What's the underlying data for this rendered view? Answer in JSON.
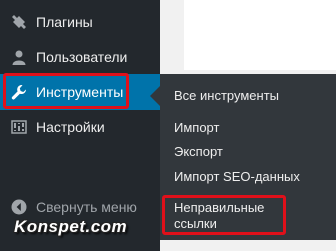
{
  "sidebar": {
    "items": [
      {
        "label": "Плагины",
        "icon": "plugin-icon"
      },
      {
        "label": "Пользователи",
        "icon": "users-icon"
      },
      {
        "label": "Инструменты",
        "icon": "wrench-icon",
        "active": true
      },
      {
        "label": "Настройки",
        "icon": "settings-icon"
      }
    ],
    "collapse_label": "Свернуть меню",
    "collapse_icon": "collapse-arrow-icon"
  },
  "submenu": {
    "items": [
      {
        "label": "Все инструменты"
      },
      {
        "label": "Импорт"
      },
      {
        "label": "Экспорт"
      },
      {
        "label": "Импорт SEO-данных"
      },
      {
        "label": "Неправильные\nссылки"
      }
    ]
  },
  "watermark": "Konspet.com",
  "colors": {
    "sidebar_bg": "#23282d",
    "submenu_bg": "#32373c",
    "active_bg": "#0073aa",
    "highlight_border": "#e0101a",
    "text": "#eeeeee"
  }
}
